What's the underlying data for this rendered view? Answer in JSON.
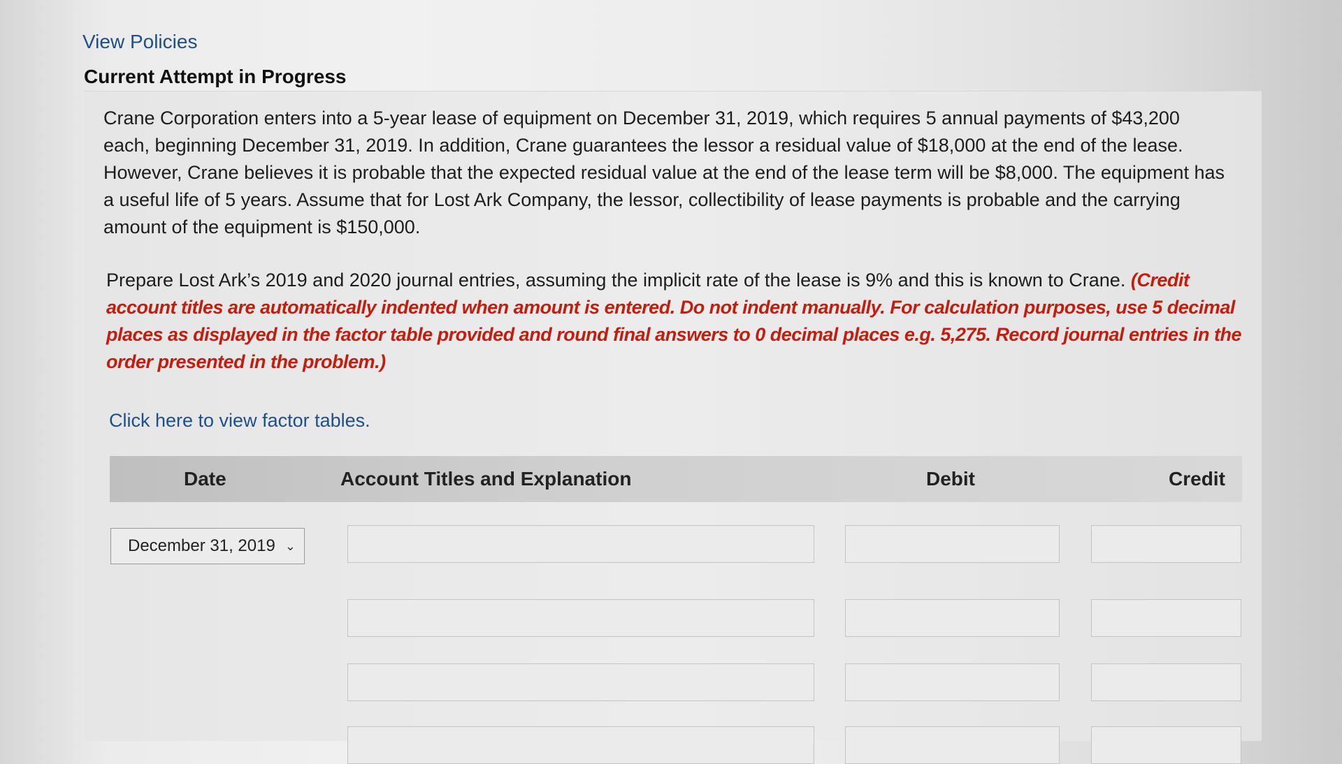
{
  "header": {
    "view_policies_link": "View Policies",
    "attempt_title": "Current Attempt in Progress"
  },
  "question": {
    "text": "Crane Corporation enters into a 5-year lease of equipment on December 31, 2019, which requires 5 annual payments of $43,200 each, beginning December 31, 2019. In addition, Crane guarantees the lessor a residual value of $18,000 at the end of the lease. However, Crane believes it is probable that the expected residual value at the end of the lease term will be $8,000. The equipment has a useful life of 5 years. Assume that for Lost Ark Company, the lessor, collectibility of lease payments is probable and the carrying amount of the equipment is $150,000.",
    "instruction_main": "Prepare Lost Ark’s 2019 and 2020 journal entries, assuming the implicit rate of the lease is 9% and this is known to Crane. ",
    "instruction_note": "(Credit account titles are automatically indented when amount is entered. Do not indent manually. For calculation purposes, use 5 decimal places as displayed in the factor table provided and round final answers to 0 decimal places e.g. 5,275. Record journal entries in the order presented in the problem.)",
    "factor_link": "Click here to view factor tables."
  },
  "journal_table": {
    "headers": {
      "date": "Date",
      "account": "Account Titles and Explanation",
      "debit": "Debit",
      "credit": "Credit"
    },
    "date_selected": "December 31, 2019",
    "rows": [
      {
        "account": "",
        "debit": "",
        "credit": ""
      },
      {
        "account": "",
        "debit": "",
        "credit": ""
      },
      {
        "account": "",
        "debit": "",
        "credit": ""
      },
      {
        "account": "",
        "debit": "",
        "credit": ""
      }
    ]
  },
  "icons": {
    "date_dropdown": "chevron-down-icon"
  }
}
